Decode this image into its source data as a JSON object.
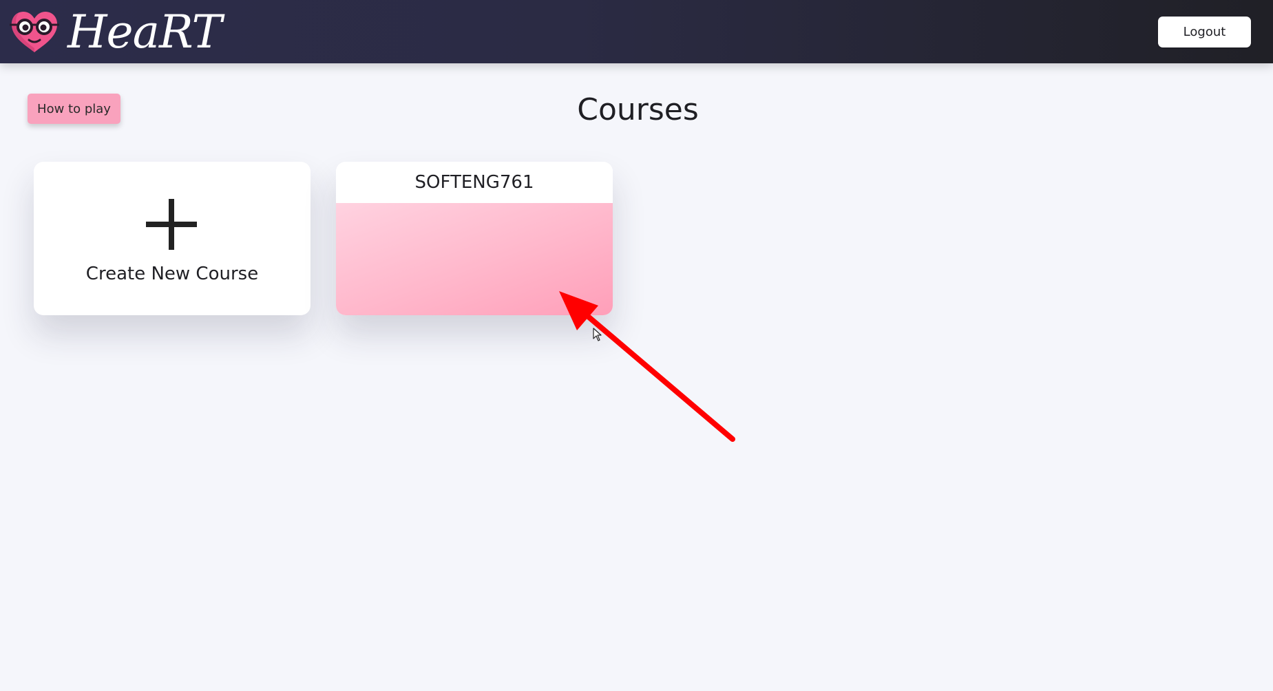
{
  "app": {
    "brand_name": "HeaRT",
    "logo_icon": "heart-glasses-logo-icon"
  },
  "header": {
    "logout_label": "Logout"
  },
  "toolbar": {
    "how_to_play_label": "How to play"
  },
  "main": {
    "title": "Courses",
    "create_card": {
      "icon": "plus-icon",
      "label": "Create New Course"
    },
    "courses": [
      {
        "title": "SOFTENG761"
      }
    ]
  },
  "colors": {
    "navbar": "#2b2b44",
    "accent_pink": "#f9a2bd",
    "annotation_red": "#ff0000",
    "page_background": "#f5f6fb"
  }
}
